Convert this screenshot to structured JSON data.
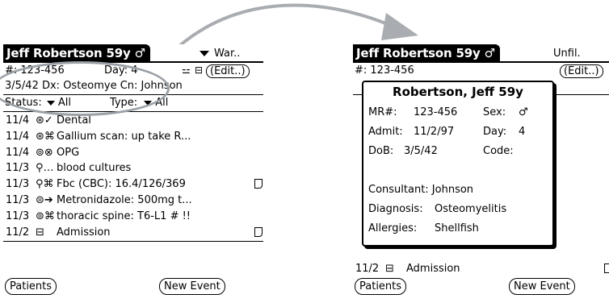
{
  "left": {
    "title": "Jeff Robertson 59y ♂",
    "view_selector": "War..",
    "record_line": "#: 123-456",
    "day_line": "Day: 4",
    "edit_label": "(Edit..)",
    "detail_line": "3/5/42    Dx: Osteomye   Cn: Johnson",
    "status_label": "Status:",
    "status_value": "All",
    "type_label": "Type:",
    "type_value": "All",
    "events": [
      {
        "date": "11/4",
        "icons": "⊛✓",
        "text": "Dental",
        "note": false
      },
      {
        "date": "11/4",
        "icons": "⊛⌘",
        "text": "Gallium scan: up take R...",
        "note": false
      },
      {
        "date": "11/4",
        "icons": "⊚⊗",
        "text": "OPG",
        "note": false
      },
      {
        "date": "11/3",
        "icons": "⚲…",
        "text": "blood cultures",
        "note": false
      },
      {
        "date": "11/3",
        "icons": "⚲⌘",
        "text": "Fbc (CBC): 16.4/126/369",
        "note": true
      },
      {
        "date": "11/3",
        "icons": "⊜➔",
        "text": "Metronidazole: 500mg t...",
        "note": false
      },
      {
        "date": "11/3",
        "icons": "⊚⌘",
        "text": "thoracic spine: T6-L1 # !!",
        "note": false
      },
      {
        "date": "11/2",
        "icons": "⊟",
        "text": "Admission",
        "note": true
      }
    ],
    "patients_button": "Patients",
    "new_event_button": "New Event"
  },
  "right": {
    "title": "Jeff Robertson 59y ♂",
    "view_selector": "Unfil.",
    "record_line": "#: 123-456",
    "edit_label": "(Edit..)",
    "last_event_date": "11/2",
    "last_event_icon": "⊟",
    "last_event_text": "Admission",
    "patients_button": "Patients",
    "new_event_button": "New Event"
  },
  "dialog": {
    "title": "Robertson, Jeff 59y",
    "mr_label": "MR#:",
    "mr_value": "123-456",
    "sex_label": "Sex:",
    "sex_value": "♂",
    "admit_label": "Admit:",
    "admit_value": "11/2/97",
    "day_label": "Day:",
    "day_value": "4",
    "dob_label": "DoB:",
    "dob_value": "3/5/42",
    "code_label": "Code:",
    "consultant_line": "Consultant: Johnson",
    "diagnosis_label": "Diagnosis:",
    "diagnosis_value": "Osteomyelitis",
    "allergies_label": "Allergies:",
    "allergies_value": "Shellfish"
  },
  "colors": {
    "arrow": "#a9acb0",
    "highlight": "#9aa0a6"
  }
}
